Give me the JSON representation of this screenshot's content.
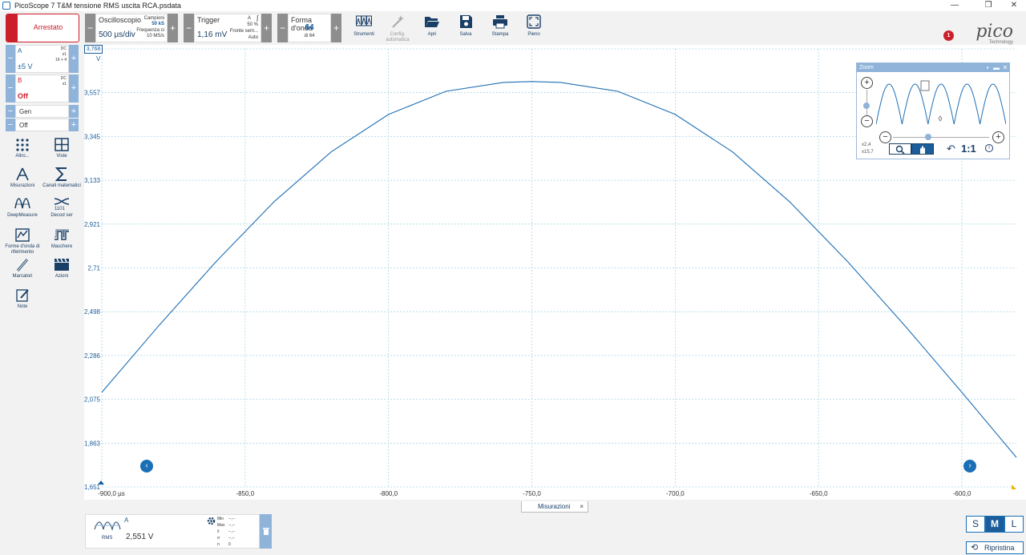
{
  "window": {
    "title": "PicoScope 7 T&M tensione RMS uscita RCA.psdata",
    "minimize": "—",
    "restore": "❐",
    "close": "✕"
  },
  "toolbar": {
    "run_label": "Arrestato",
    "minus": "−",
    "plus": "+",
    "scope": {
      "title": "Oscilloscopio",
      "timebase": "500 µs/div",
      "samples_label": "Campioni",
      "samples_value": "50 kS",
      "rate_label": "Frequenza ci",
      "rate_value": "10 MS/s"
    },
    "trigger": {
      "title": "Trigger",
      "level": "1,16 mV",
      "channel": "A",
      "edge_glyph": "ʃ",
      "pretrigger": "50 %",
      "edge_type": "Fronte sem...",
      "mode": "Auto"
    },
    "waveform": {
      "title": "Forma d'onda",
      "current": "64",
      "of_total": "di 64"
    },
    "tools": [
      {
        "name": "strumenti",
        "label": "Strumenti",
        "enabled": true
      },
      {
        "name": "config-automatica",
        "label": "Config. automatica",
        "enabled": false
      },
      {
        "name": "apri",
        "label": "Apri",
        "enabled": true
      },
      {
        "name": "salva",
        "label": "Salva",
        "enabled": true
      },
      {
        "name": "stampa",
        "label": "Stampa",
        "enabled": true
      },
      {
        "name": "pieno",
        "label": "Pieno",
        "enabled": true
      }
    ],
    "notification_count": "1",
    "brand_word": "pico",
    "brand_sub": "Technology"
  },
  "channels": {
    "a": {
      "name": "A",
      "coupling": "DC",
      "probe": "x1",
      "resolution": "16 + 4",
      "range": "±5 V"
    },
    "b": {
      "name": "B",
      "coupling": "DC",
      "probe": "x1",
      "range": "Off"
    },
    "gen": {
      "name": "Gen",
      "state": "Off"
    }
  },
  "sidebar": [
    {
      "name": "altro",
      "label": "Altro..."
    },
    {
      "name": "viste",
      "label": "Viste"
    },
    {
      "name": "misurazioni",
      "label": "Misurazioni"
    },
    {
      "name": "canali-matematici",
      "label": "Canali matematici"
    },
    {
      "name": "deepmeasure",
      "label": "DeepMeasure"
    },
    {
      "name": "decod-ser",
      "label": "Decod ser"
    },
    {
      "name": "forme-onda-riferimento",
      "label": "Forme d'onda di riferimento"
    },
    {
      "name": "maschere",
      "label": "Maschere"
    },
    {
      "name": "marcatori",
      "label": "Marcatori"
    },
    {
      "name": "azioni",
      "label": "Azioni"
    },
    {
      "name": "note",
      "label": "Note"
    }
  ],
  "chart_data": {
    "type": "line",
    "ylabel": "V",
    "y_ticks": [
      "3,768",
      "3,557",
      "3,345",
      "3,133",
      "2,921",
      "2,71",
      "2,498",
      "2,286",
      "2,075",
      "1,863",
      "1,651"
    ],
    "x_ticks": [
      "-900,0 µs",
      "-850,0",
      "-800,0",
      "-750,0",
      "-700,0",
      "-650,0",
      "-600,0"
    ],
    "xlim": [
      -900,
      -581
    ],
    "ylim": [
      1.651,
      3.768
    ],
    "grid": true,
    "series": [
      {
        "name": "A",
        "color": "#1f6fb4",
        "x": [
          -900,
          -880,
          -860,
          -840,
          -820,
          -800,
          -780,
          -760,
          -750,
          -740,
          -720,
          -700,
          -680,
          -660,
          -640,
          -620,
          -600,
          -581
        ],
        "y": [
          2.108,
          2.432,
          2.742,
          3.028,
          3.27,
          3.451,
          3.563,
          3.606,
          3.61,
          3.606,
          3.563,
          3.451,
          3.27,
          3.028,
          2.742,
          2.432,
          2.108,
          1.794
        ]
      }
    ],
    "nav_left": "‹",
    "nav_right": "›"
  },
  "zoom_window": {
    "title": "Zoom",
    "scale_x": "x2,4",
    "scale_y": "x15,7",
    "one_to_one": "1:1",
    "zoom_in": "+",
    "zoom_out": "−",
    "info": "i"
  },
  "measurements": {
    "tab_label": "Misurazioni",
    "tab_close": "×",
    "channel": "A",
    "type": "RMS",
    "value": "2,551 V",
    "stats": [
      {
        "label": "Min",
        "value": "--,--"
      },
      {
        "label": "Max",
        "value": "--,--"
      },
      {
        "label": "x̄",
        "value": "--,--"
      },
      {
        "label": "σ",
        "value": "--,--"
      },
      {
        "label": "n",
        "value": "0"
      }
    ]
  },
  "view_size": {
    "s": "S",
    "m": "M",
    "l": "L"
  },
  "reset_label": "Ripristina"
}
